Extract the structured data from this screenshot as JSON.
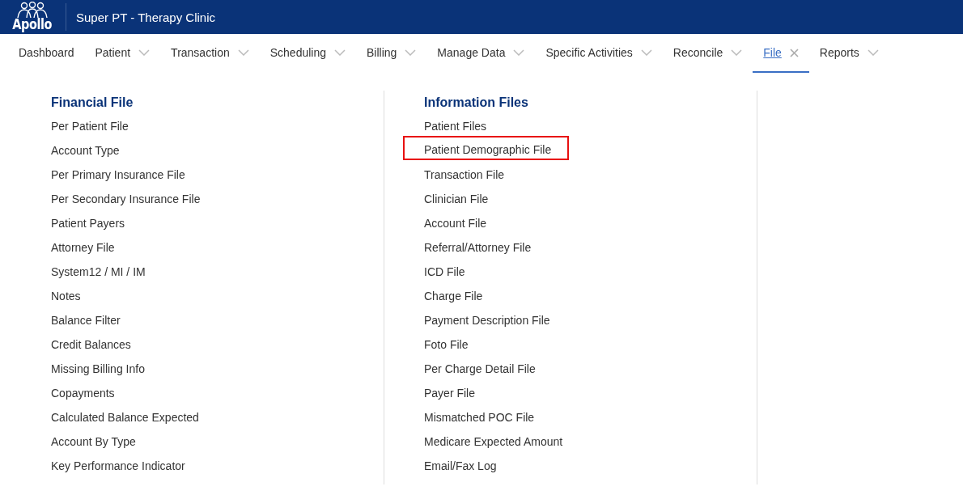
{
  "header": {
    "logo_text": "Apollo",
    "title": "Super PT - Therapy Clinic"
  },
  "nav": [
    {
      "label": "Dashboard",
      "dropdown": false,
      "selected": false
    },
    {
      "label": "Patient",
      "dropdown": true,
      "selected": false
    },
    {
      "label": "Transaction",
      "dropdown": true,
      "selected": false
    },
    {
      "label": "Scheduling",
      "dropdown": true,
      "selected": false
    },
    {
      "label": "Billing",
      "dropdown": true,
      "selected": false
    },
    {
      "label": "Manage Data",
      "dropdown": true,
      "selected": false
    },
    {
      "label": "Specific Activities",
      "dropdown": true,
      "selected": false
    },
    {
      "label": "Reconcile",
      "dropdown": true,
      "selected": false
    },
    {
      "label": "File",
      "dropdown": true,
      "selected": true
    },
    {
      "label": "Reports",
      "dropdown": true,
      "selected": false
    }
  ],
  "columns": [
    {
      "heading": "Financial File",
      "items": [
        {
          "label": "Per Patient File",
          "highlighted": false
        },
        {
          "label": "Account Type",
          "highlighted": false
        },
        {
          "label": "Per Primary Insurance File",
          "highlighted": false
        },
        {
          "label": "Per Secondary Insurance File",
          "highlighted": false
        },
        {
          "label": "Patient Payers",
          "highlighted": false
        },
        {
          "label": "Attorney File",
          "highlighted": false
        },
        {
          "label": "System12 / MI / IM",
          "highlighted": false
        },
        {
          "label": "Notes",
          "highlighted": false
        },
        {
          "label": "Balance Filter",
          "highlighted": false
        },
        {
          "label": "Credit Balances",
          "highlighted": false
        },
        {
          "label": "Missing Billing Info",
          "highlighted": false
        },
        {
          "label": "Copayments",
          "highlighted": false
        },
        {
          "label": "Calculated Balance Expected",
          "highlighted": false
        },
        {
          "label": "Account By Type",
          "highlighted": false
        },
        {
          "label": "Key Performance Indicator",
          "highlighted": false
        }
      ]
    },
    {
      "heading": "Information Files",
      "items": [
        {
          "label": "Patient Files",
          "highlighted": false
        },
        {
          "label": "Patient Demographic File",
          "highlighted": true
        },
        {
          "label": "Transaction File",
          "highlighted": false
        },
        {
          "label": "Clinician File",
          "highlighted": false
        },
        {
          "label": "Account File",
          "highlighted": false
        },
        {
          "label": "Referral/Attorney File",
          "highlighted": false
        },
        {
          "label": "ICD File",
          "highlighted": false
        },
        {
          "label": "Charge File",
          "highlighted": false
        },
        {
          "label": "Payment Description File",
          "highlighted": false
        },
        {
          "label": "Foto File",
          "highlighted": false
        },
        {
          "label": "Per Charge Detail File",
          "highlighted": false
        },
        {
          "label": "Payer File",
          "highlighted": false
        },
        {
          "label": "Mismatched POC File",
          "highlighted": false
        },
        {
          "label": "Medicare Expected Amount",
          "highlighted": false
        },
        {
          "label": "Email/Fax Log",
          "highlighted": false
        }
      ]
    }
  ]
}
